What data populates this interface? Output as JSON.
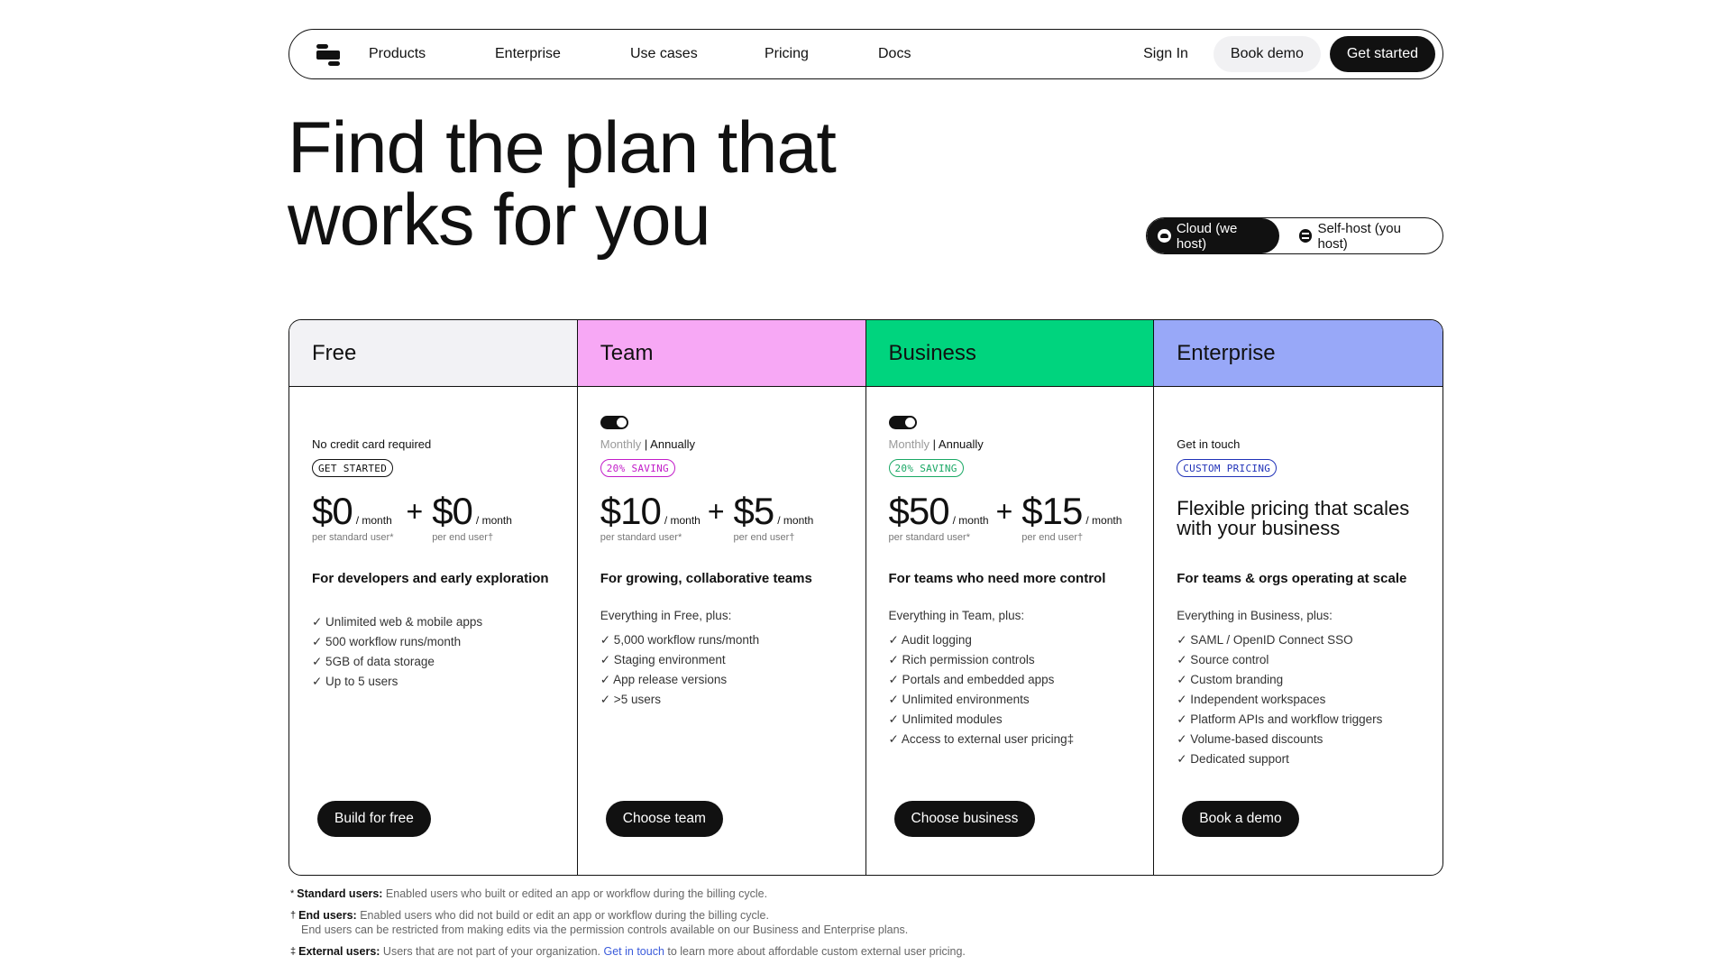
{
  "nav": {
    "logo": "logo-icon",
    "links": [
      "Products",
      "Enterprise",
      "Use cases",
      "Pricing",
      "Docs"
    ],
    "sign_in": "Sign In",
    "book_demo": "Book demo",
    "get_started": "Get started"
  },
  "hero": {
    "line1": "Find the plan that",
    "line2": "works for you"
  },
  "hosting": {
    "options": [
      {
        "label": "Cloud (we host)",
        "icon": "cloud-icon",
        "selected": true
      },
      {
        "label": "Self-host (you host)",
        "icon": "server-icon",
        "selected": false
      }
    ]
  },
  "colors": {
    "free_header": "#f2f2f5",
    "team_header": "#f7a8f5",
    "business_header": "#00d47e",
    "enterprise_header": "#98a8f8",
    "team_badge": "#c21cc9",
    "business_badge": "#1aa865",
    "enterprise_badge": "#2032b8",
    "link": "#3b5bdb"
  },
  "plans": [
    {
      "name": "Free",
      "subtitle": "No credit card required",
      "badge": "GET STARTED",
      "price_standard": "$0",
      "price_end": "$0",
      "per": "/ month",
      "standard_label": "per standard user*",
      "end_label": "per end user†",
      "tagline": "For developers and early exploration",
      "features": [
        "✓ Unlimited web & mobile apps",
        "✓ 500 workflow runs/month",
        "✓ 5GB of data storage",
        "✓ Up to 5 users"
      ],
      "cta": "Build for free"
    },
    {
      "name": "Team",
      "billing_monthly": "Monthly",
      "billing_sep": " | ",
      "billing_annually": "Annually",
      "billing_toggle": "annually",
      "badge": "20% SAVING",
      "price_standard": "$10",
      "price_end": "$5",
      "per": "/ month",
      "standard_label": "per standard user*",
      "end_label": "per end user†",
      "tagline": "For growing, collaborative teams",
      "intro": "Everything in Free, plus:",
      "features": [
        "✓ 5,000 workflow runs/month",
        "✓ Staging environment",
        "✓ App release versions",
        "✓ >5 users"
      ],
      "cta": "Choose team"
    },
    {
      "name": "Business",
      "billing_monthly": "Monthly",
      "billing_sep": " | ",
      "billing_annually": "Annually",
      "billing_toggle": "annually",
      "badge": "20% SAVING",
      "price_standard": "$50",
      "price_end": "$15",
      "per": "/ month",
      "standard_label": "per standard user*",
      "end_label": "per end user†",
      "tagline": "For teams who need more control",
      "intro": "Everything in Team, plus:",
      "features": [
        "✓ Audit logging",
        "✓ Rich permission controls",
        "✓ Portals and embedded apps",
        "✓ Unlimited environments",
        "✓ Unlimited modules",
        "✓ Access to external user pricing‡"
      ],
      "cta": "Choose business"
    },
    {
      "name": "Enterprise",
      "subtitle": "Get in touch",
      "badge": "CUSTOM PRICING",
      "headline": "Flexible pricing that scales with your business",
      "tagline": "For teams & orgs operating at scale",
      "intro": "Everything in Business, plus:",
      "features": [
        "✓ SAML / OpenID Connect SSO",
        "✓ Source control",
        "✓ Custom branding",
        "✓ Independent workspaces",
        "✓ Platform APIs and workflow triggers",
        "✓ Volume-based discounts",
        "✓ Dedicated support"
      ],
      "cta": "Book a demo"
    }
  ],
  "footnotes": {
    "standard": {
      "symbol": "*",
      "term": "Standard users:",
      "text": " Enabled users who built or edited an app or workflow during the billing cycle."
    },
    "end": {
      "symbol": "†",
      "term": "End users:",
      "text": " Enabled users who did not build or edit an app or workflow during the billing cycle.",
      "text2": "End users can be restricted from making edits via the permission controls available on our Business and Enterprise plans."
    },
    "external": {
      "symbol": "‡",
      "term": "External users:",
      "text": " Users that are not part of your organization. ",
      "link": "Get in touch",
      "text_after": " to learn more about affordable custom external user pricing."
    }
  }
}
